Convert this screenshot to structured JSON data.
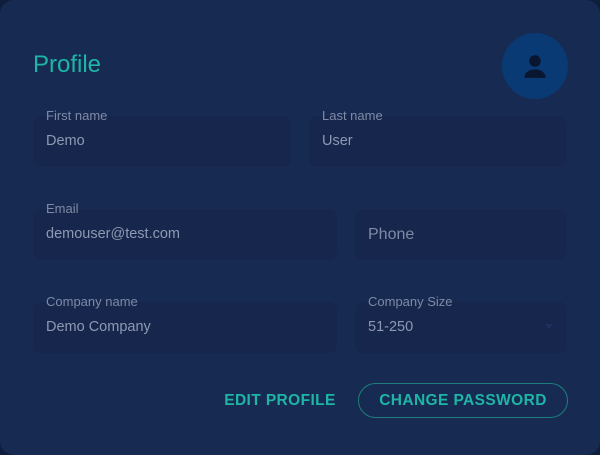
{
  "profile": {
    "title": "Profile",
    "avatar_icon": "user-icon"
  },
  "form": {
    "first_name": {
      "label": "First name",
      "value": "Demo"
    },
    "last_name": {
      "label": "Last name",
      "value": "User"
    },
    "email": {
      "label": "Email",
      "value": "demouser@test.com"
    },
    "phone": {
      "placeholder": "Phone",
      "value": ""
    },
    "company_name": {
      "label": "Company name",
      "value": "Demo Company"
    },
    "company_size": {
      "label": "Company Size",
      "value": "51-250"
    }
  },
  "actions": {
    "edit_label": "EDIT PROFILE",
    "change_password_label": "CHANGE PASSWORD"
  },
  "colors": {
    "accent": "#1fb5a6",
    "card_bg": "#172a52",
    "field_bg": "#16264c",
    "avatar_bg": "#0a3a73"
  }
}
